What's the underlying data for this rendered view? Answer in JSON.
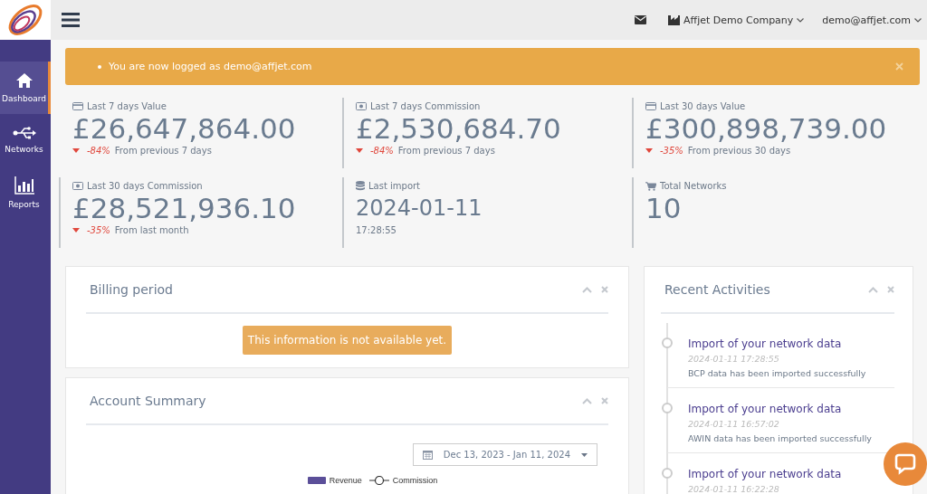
{
  "sidebar": {
    "items": [
      {
        "label": "Dashboard",
        "selected": true
      },
      {
        "label": "Networks",
        "selected": false
      },
      {
        "label": "Reports",
        "selected": false
      }
    ]
  },
  "header": {
    "company": "Affjet Demo Company",
    "user": "demo@affjet.com"
  },
  "alert": {
    "message": "You are now logged as demo@affjet.com"
  },
  "stats": [
    {
      "label": "Last 7 days Value",
      "value": "£26,647,864.00",
      "down": true,
      "change": "-84%",
      "note": "From previous 7 days"
    },
    {
      "label": "Last 7 days Commission",
      "value": "£2,530,684.70",
      "down": true,
      "change": "-84%",
      "note": "From previous 7 days"
    },
    {
      "label": "Last 30 days Value",
      "value": "£300,898,739.00",
      "down": true,
      "change": "-35%",
      "note": "From previous 30 days"
    },
    {
      "label": "Last 30 days Commission",
      "value": "£28,521,936.10",
      "down": true,
      "change": "-35%",
      "note": "From last month"
    },
    {
      "label": "Last import",
      "value": "2024-01-11",
      "note": "17:28:55"
    },
    {
      "label": "Total Networks",
      "value": "10"
    }
  ],
  "billing": {
    "title": "Billing period",
    "message": "This information is not available yet."
  },
  "summary": {
    "title": "Account Summary",
    "date_range": "Dec 13, 2023 - Jan 11, 2024",
    "legend": [
      {
        "label": "Revenue",
        "kind": "bar"
      },
      {
        "label": "Commission",
        "kind": "line"
      }
    ]
  },
  "activities": {
    "title": "Recent Activities",
    "items": [
      {
        "title": "Import of your network data",
        "time": "2024-01-11 17:28:55",
        "text": "BCP data has been imported successfully"
      },
      {
        "title": "Import of your network data",
        "time": "2024-01-11 16:57:02",
        "text": "AWIN data has been imported successfully"
      },
      {
        "title": "Import of your network data",
        "time": "2024-01-11 16:22:28"
      }
    ]
  }
}
